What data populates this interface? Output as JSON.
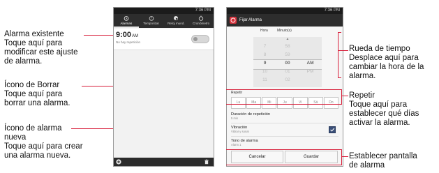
{
  "annotations": {
    "existing": {
      "title": "Alarma existente",
      "desc": [
        "Toque aquí para",
        "modificar este ajuste",
        "de alarma."
      ]
    },
    "delete": {
      "title": "Ícono de Borrar",
      "desc": [
        "Toque aquí para",
        "borrar una alarma."
      ]
    },
    "new": {
      "title": [
        "Ícono de alarma",
        "nueva"
      ],
      "desc": [
        "Toque aquí para crear",
        "una alarma nueva."
      ]
    },
    "wheel": {
      "title": "Rueda de tiempo",
      "desc": [
        "Desplace aquí para",
        "cambiar la hora de la",
        "alarma."
      ]
    },
    "repeat": {
      "title": "Repetir",
      "desc": [
        "Toque aquí para",
        "establecer qué días",
        "activar la alarma."
      ]
    },
    "set": {
      "title": [
        "Establecer pantalla",
        "de alarma"
      ]
    }
  },
  "left_phone": {
    "status_time": "7:36 PM",
    "tabs": [
      "Alarmas",
      "Temporizar",
      "Reloj mund.",
      "Cronómetro"
    ],
    "alarm_time": "9:00",
    "alarm_ampm": "AM",
    "alarm_sub": "No hay repetición"
  },
  "right_phone": {
    "status_time": "7:36 PM",
    "title": "Fijar Alarma",
    "col_hour": "Hora",
    "col_min": "Minuto(s)",
    "hours": [
      "7",
      "8",
      "9",
      "10",
      "11"
    ],
    "minutes": [
      "58",
      "59",
      "00",
      "01",
      "02"
    ],
    "ampm": [
      "",
      "",
      "AM",
      "PM",
      ""
    ],
    "repeat_label": "Repetir",
    "days": [
      "Lu",
      "Ma",
      "Mi",
      "Ju",
      "Vi",
      "Sá",
      "Do"
    ],
    "repeat_duration": "Duración de repetición",
    "repeat_duration_sub": "5 min",
    "vibration": "Vibración",
    "vibration_sub": "Vibrar y sonar",
    "ringtone": "Tono de alarma",
    "ringtone_sub": "Alarm 1",
    "cancel": "Cancelar",
    "save": "Guardar"
  }
}
